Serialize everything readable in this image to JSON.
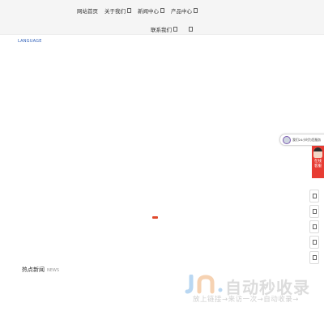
{
  "nav": {
    "row1": [
      {
        "label": "网站首页",
        "has_caret": false
      },
      {
        "label": "关于我们",
        "has_caret": true
      },
      {
        "label": "新闻中心",
        "has_caret": true
      },
      {
        "label": "产品中心",
        "has_caret": true
      }
    ],
    "row2": [
      {
        "label": "联系我们",
        "has_caret": true
      },
      {
        "label": "",
        "has_caret": true
      }
    ]
  },
  "language_label": "LANGUAGE",
  "section": {
    "title": "热点新闻",
    "subtitle": "NEWS"
  },
  "customer_service": {
    "pill_text": "我们24小时为您服务",
    "badge_label_line1": "在线",
    "badge_label_line2": "客服"
  },
  "watermark": {
    "title": "自动秒收录",
    "subtitle": "放上链接→来访一次→自动收录→"
  },
  "colors": {
    "accent_red": "#e73c33",
    "slider_dot": "#e04a2d",
    "language_blue": "#2f5fb8",
    "watermark_logo_blue": "#b9d7f2",
    "watermark_logo_orange": "#f6d2b2"
  }
}
